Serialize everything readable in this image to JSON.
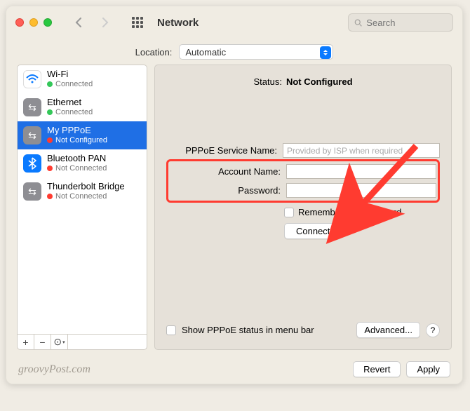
{
  "window": {
    "title": "Network"
  },
  "search": {
    "placeholder": "Search"
  },
  "location": {
    "label": "Location:",
    "value": "Automatic"
  },
  "sidebar": {
    "items": [
      {
        "name": "Wi-Fi",
        "status": "Connected",
        "dot": "green",
        "icon": "wifi"
      },
      {
        "name": "Ethernet",
        "status": "Connected",
        "dot": "green",
        "icon": "eth"
      },
      {
        "name": "My PPPoE",
        "status": "Not Configured",
        "dot": "red",
        "icon": "ppp",
        "selected": true
      },
      {
        "name": "Bluetooth PAN",
        "status": "Not Connected",
        "dot": "red",
        "icon": "bt"
      },
      {
        "name": "Thunderbolt Bridge",
        "status": "Not Connected",
        "dot": "red",
        "icon": "tb"
      }
    ]
  },
  "panel": {
    "status_label": "Status:",
    "status_value": "Not Configured",
    "fields": {
      "service_name_label": "PPPoE Service Name:",
      "service_name_placeholder": "Provided by ISP when required",
      "account_label": "Account Name:",
      "password_label": "Password:"
    },
    "remember_label": "Remember this password",
    "connect_label": "Connect",
    "show_status_label": "Show PPPoE status in menu bar",
    "advanced_label": "Advanced...",
    "help_label": "?"
  },
  "footer": {
    "watermark": "groovyPost.com",
    "revert_label": "Revert",
    "apply_label": "Apply"
  }
}
